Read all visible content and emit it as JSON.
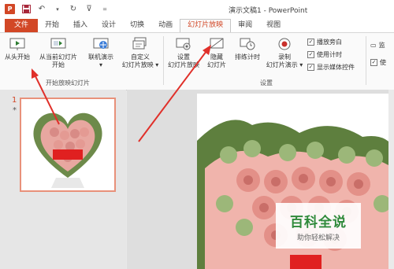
{
  "window": {
    "title": "演示文稿1 - PowerPoint"
  },
  "tabs": [
    {
      "label": "文件"
    },
    {
      "label": "开始"
    },
    {
      "label": "插入"
    },
    {
      "label": "设计"
    },
    {
      "label": "切换"
    },
    {
      "label": "动画"
    },
    {
      "label": "幻灯片放映"
    },
    {
      "label": "审阅"
    },
    {
      "label": "视图"
    }
  ],
  "ribbon": {
    "group1": {
      "label": "开始放映幻灯片",
      "from_start": "从头开始",
      "from_current_1": "从当前幻灯片",
      "from_current_2": "开始",
      "online_1": "联机演示",
      "online_2": "▾",
      "custom_1": "自定义",
      "custom_2": "幻灯片放映 ▾"
    },
    "group2": {
      "label": "设置",
      "setup_1": "设置",
      "setup_2": "幻灯片放映",
      "hide_1": "隐藏",
      "hide_2": "幻灯片",
      "rehearse": "排练计时",
      "record_1": "录制",
      "record_2": "幻灯片演示 ▾",
      "check_narration": "播放旁白",
      "check_timing": "使用计时",
      "check_media": "显示媒体控件"
    },
    "group3": {
      "monitor": "监",
      "use": "使"
    }
  },
  "slides_pane": {
    "number": "1",
    "marker": "*"
  },
  "watermark": {
    "title": "百科全说",
    "subtitle": "助你轻松解决"
  },
  "colors": {
    "accent": "#d24726",
    "annotation": "#e0302a",
    "watermark_green": "#2f8a3b"
  }
}
